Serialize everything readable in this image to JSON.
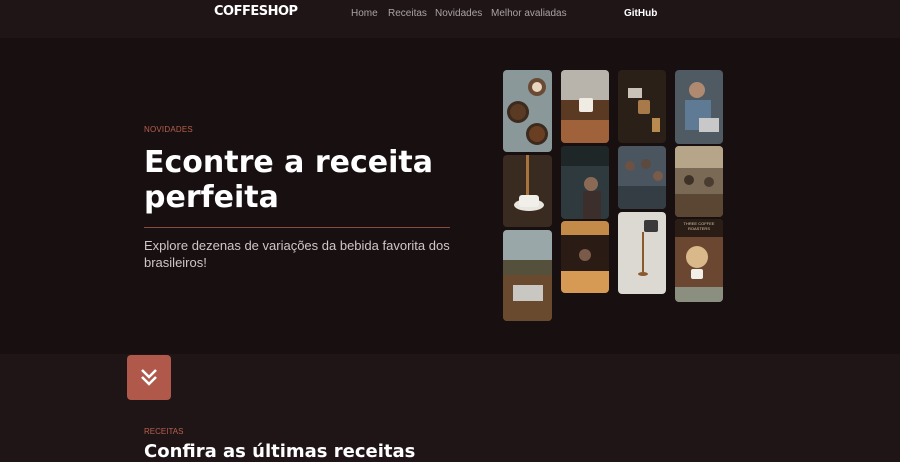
{
  "nav": {
    "logo": "COFFESHOP",
    "links": [
      "Home",
      "Receitas",
      "Novidades",
      "Melhor avaliadas"
    ],
    "github": "GitHub"
  },
  "hero": {
    "eyebrow": "NOVIDADES",
    "title": "Econtre a receita perfeita",
    "subtitle": "Explore dezenas de variações da bebida favorita dos brasileiros!"
  },
  "gallery": {
    "tiles": [
      {
        "name": "coffee-beans-latte-art",
        "color": "#7a8a8c"
      },
      {
        "name": "hand-holding-cup-window",
        "color": "#5a3a22"
      },
      {
        "name": "barista-pouring-milk",
        "color": "#3a2e22"
      },
      {
        "name": "man-with-laptop",
        "color": "#4f5a63"
      },
      {
        "name": "coffee-dripping-cup",
        "color": "#8c6a45"
      },
      {
        "name": "people-in-cafe-dark",
        "color": "#2f3a3e"
      },
      {
        "name": "cafe-interior-crowd",
        "color": "#4a5560"
      },
      {
        "name": "cafe-seating-area",
        "color": "#7a6a55"
      },
      {
        "name": "laptop-window-table",
        "color": "#55503c"
      },
      {
        "name": "bar-counter-lights",
        "color": "#c48a48"
      },
      {
        "name": "pouring-coffee-white",
        "color": "#d6d2cc"
      },
      {
        "name": "woman-drinking-coffee",
        "color": "#6b4630"
      }
    ],
    "cafe_sign": "THREE COFFEE ROASTERS"
  },
  "recipes": {
    "eyebrow": "RECEITAS",
    "title": "Confira as últimas receitas"
  }
}
